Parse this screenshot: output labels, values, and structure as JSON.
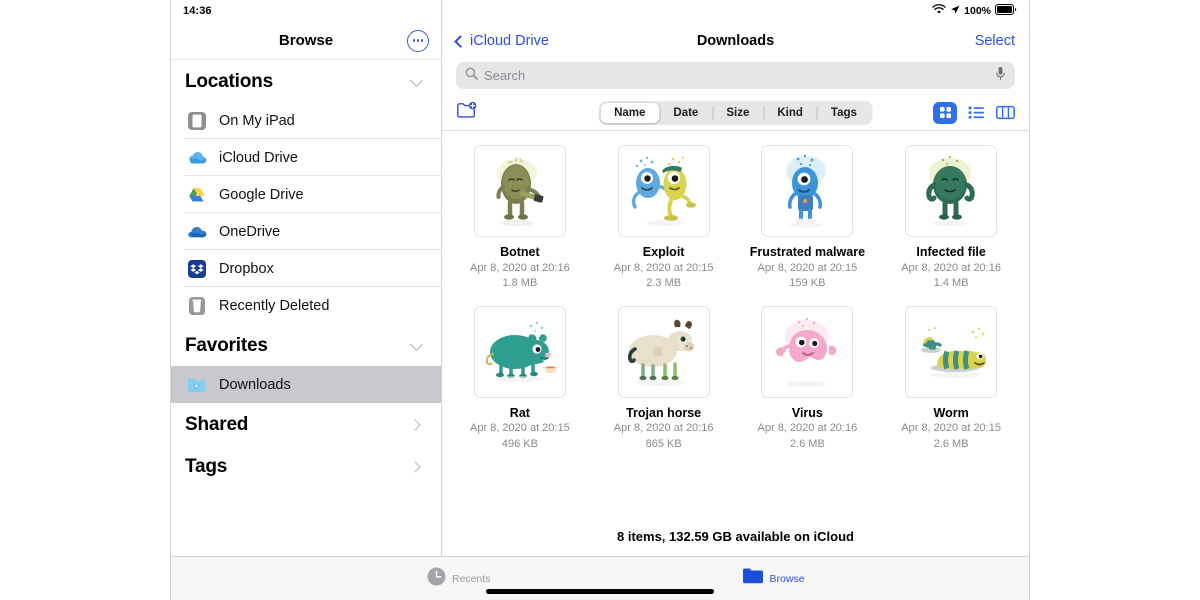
{
  "status_bar": {
    "time": "14:36",
    "wifi_icon": "wifi-icon",
    "location_icon": "location-arrow-icon",
    "battery_percent": "100%",
    "battery_icon": "battery-full-icon"
  },
  "sidebar": {
    "title": "Browse",
    "more_button_icon": "ellipsis-circle-icon",
    "sections": [
      {
        "heading": "Locations",
        "collapse_icon": "chevron-down-icon",
        "items": [
          {
            "label": "On My iPad",
            "icon": "ipad-icon"
          },
          {
            "label": "iCloud Drive",
            "icon": "icloud-drive-icon"
          },
          {
            "label": "Google Drive",
            "icon": "google-drive-icon"
          },
          {
            "label": "OneDrive",
            "icon": "onedrive-icon"
          },
          {
            "label": "Dropbox",
            "icon": "dropbox-icon"
          },
          {
            "label": "Recently Deleted",
            "icon": "trash-icon"
          }
        ]
      },
      {
        "heading": "Favorites",
        "collapse_icon": "chevron-down-icon",
        "items": [
          {
            "label": "Downloads",
            "icon": "downloads-folder-icon",
            "selected": true
          }
        ]
      }
    ],
    "links": [
      {
        "label": "Shared",
        "icon": "chevron-right-icon"
      },
      {
        "label": "Tags",
        "icon": "chevron-right-icon"
      }
    ]
  },
  "main": {
    "back_label": "iCloud Drive",
    "back_icon": "chevron-left-icon",
    "title": "Downloads",
    "select_label": "Select",
    "search": {
      "placeholder": "Search",
      "value": "",
      "search_icon": "search-icon",
      "mic_icon": "microphone-icon"
    },
    "toolbar": {
      "new_folder_icon": "new-folder-icon",
      "sort_options": [
        "Name",
        "Date",
        "Size",
        "Kind",
        "Tags"
      ],
      "sort_selected": "Name",
      "view_modes": [
        {
          "icon": "grid-view-icon",
          "active": true
        },
        {
          "icon": "list-view-icon",
          "active": false
        },
        {
          "icon": "column-view-icon",
          "active": false
        }
      ]
    },
    "files": [
      {
        "name": "Botnet",
        "date": "Apr 8, 2020 at 20:16",
        "size": "1.8 MB",
        "icon": "botnet-character-icon"
      },
      {
        "name": "Exploit",
        "date": "Apr 8, 2020 at 20:15",
        "size": "2.3 MB",
        "icon": "exploit-character-icon"
      },
      {
        "name": "Frustrated malware",
        "date": "Apr 8, 2020 at 20:15",
        "size": "159 KB",
        "icon": "frustrated-malware-character-icon"
      },
      {
        "name": "Infected file",
        "date": "Apr 8, 2020 at 20:16",
        "size": "1.4 MB",
        "icon": "infected-file-character-icon"
      },
      {
        "name": "Rat",
        "date": "Apr 8, 2020 at 20:15",
        "size": "496 KB",
        "icon": "rat-character-icon"
      },
      {
        "name": "Trojan horse",
        "date": "Apr 8, 2020 at 20:16",
        "size": "865 KB",
        "icon": "trojan-horse-character-icon"
      },
      {
        "name": "Virus",
        "date": "Apr 8, 2020 at 20:16",
        "size": "2.6 MB",
        "icon": "virus-character-icon"
      },
      {
        "name": "Worm",
        "date": "Apr 8, 2020 at 20:15",
        "size": "2.6 MB",
        "icon": "worm-character-icon"
      }
    ],
    "status_text": "8 items, 132.59 GB available on iCloud"
  },
  "tab_bar": {
    "tabs": [
      {
        "label": "Recents",
        "icon": "clock-icon",
        "active": false
      },
      {
        "label": "Browse",
        "icon": "folder-icon",
        "active": true
      }
    ]
  },
  "colors": {
    "accent_blue": "#2f4fd8",
    "view_active_blue": "#2f6fe8",
    "selected_row": "#c9c9cd",
    "search_bg": "#e6e6e8"
  }
}
